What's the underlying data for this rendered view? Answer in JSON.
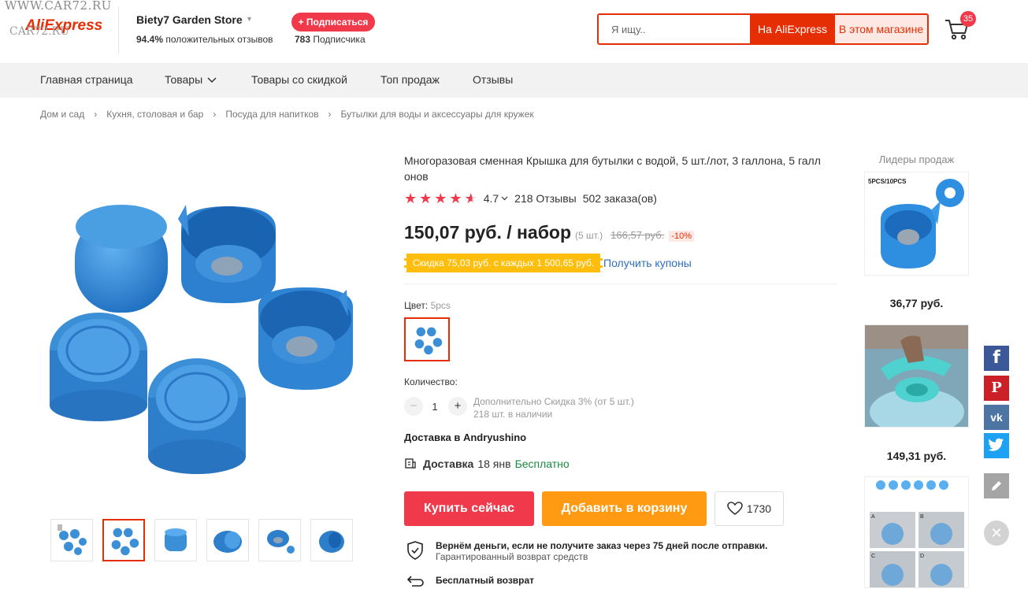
{
  "watermark": "WWW.CAR72.RU",
  "watermark2": "CAR72.RU",
  "logo": "AliExpress",
  "store": {
    "name": "Biety7 Garden Store",
    "positive_pct": "94.4%",
    "positive_label": "положительных отзывов",
    "subscribe_label": "+ Подписаться",
    "subscribers_count": "783",
    "subscribers_label": "Подписчика"
  },
  "search": {
    "placeholder": "Я ищу..",
    "btn_aliexpress": "На AliExpress",
    "btn_store": "В этом магазине"
  },
  "cart": {
    "count": "35"
  },
  "nav": [
    "Главная страница",
    "Товары",
    "Товары со скидкой",
    "Топ продаж",
    "Отзывы"
  ],
  "breadcrumb": [
    "Дом и сад",
    "Кухня, столовая и бар",
    "Посуда для напитков",
    "Бутылки для воды и аксессуары для кружек"
  ],
  "product": {
    "title": "Многоразовая сменная Крышка для бутылки с водой, 5 шт./лот, 3 галлона, 5 галл онов",
    "rating": "4.7",
    "stars": 4.7,
    "reviews": "218 Отзывы",
    "orders": "502 заказа(ов)",
    "price": "150,07 руб. / набор",
    "price_qty": "(5 шт.)",
    "old_price": "166,57 руб.",
    "discount": "-10%",
    "coupon": "Скидка 75,03 руб. с каждых 1 500,65 руб.",
    "get_coupons": "Получить купоны",
    "color_label": "Цвет:",
    "color_value": "5pcs",
    "qty_label": "Количество:",
    "qty_minus": "−",
    "qty_plus": "+",
    "qty_value": "1",
    "qty_extra_1": "Дополнительно Скидка 3% (от 5 шт.)",
    "qty_extra_2": "218 шт. в наличии",
    "delivery_to": "Доставка в Andryushino",
    "delivery_label": "Доставка",
    "delivery_date": "18 янв",
    "delivery_free": "Бесплатно",
    "buy_now": "Купить сейчас",
    "add_to_cart": "Добавить в корзину",
    "wishlist_count": "1730",
    "guarantee_title": "Вернём деньги, если не получите заказ через 75 дней после отправки.",
    "guarantee_sub": "Гарантированный возврат средств",
    "return_title": "Бесплатный возврат"
  },
  "leaders": {
    "title": "Лидеры продаж",
    "img1_label": "5PCS/10PCS",
    "prices": [
      "36,77 руб.",
      "149,31 руб."
    ],
    "diagram_letters": [
      "A",
      "B",
      "C",
      "D"
    ]
  },
  "share": {
    "facebook": "f",
    "pinterest": "P",
    "vk": "vk",
    "twitter": "t",
    "edit_icon": "pencil-icon",
    "close": "✕"
  },
  "colors": {
    "accent": "#e62e04",
    "buy": "#f0394a",
    "cart": "#ff9a12",
    "coupon": "#ffbe0b",
    "cap_blue": "#3a8fd6",
    "facebook": "#3b5998",
    "pinterest": "#cb2027",
    "vk": "#4c75a3",
    "twitter": "#1da1f2"
  }
}
